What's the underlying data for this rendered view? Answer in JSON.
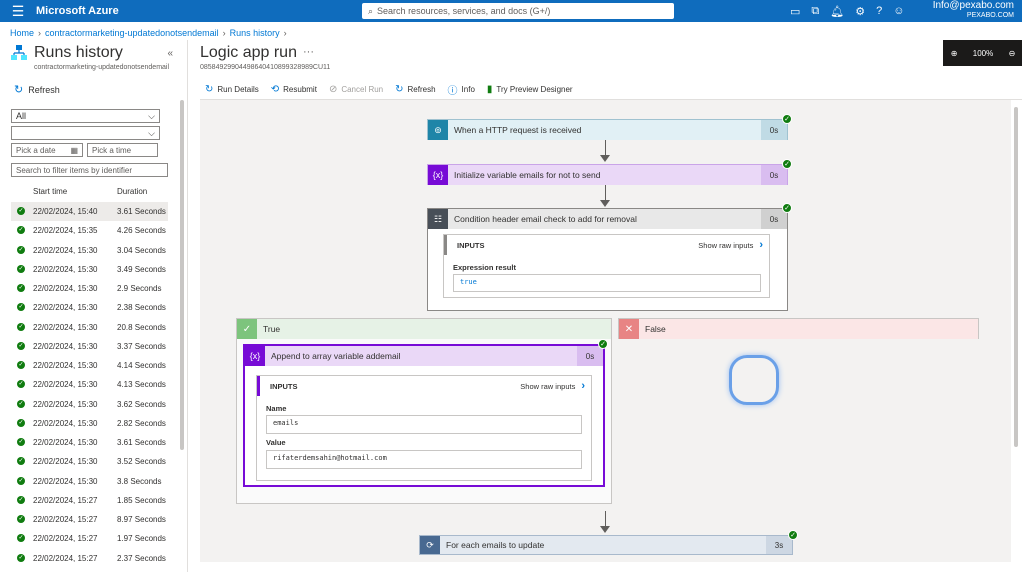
{
  "topbar": {
    "brand": "Microsoft Azure",
    "search_placeholder": "Search resources, services, and docs (G+/)",
    "user_email": "Info@pexabo.com",
    "user_tenant": "PEXABO.COM"
  },
  "breadcrumb": [
    "Home",
    "contractormarketing-updatedonotsendemail",
    "Runs history"
  ],
  "left": {
    "title": "Runs history",
    "subtitle": "contractormarketing-updatedonotsendemail",
    "refresh_label": "Refresh",
    "filter_status": "All",
    "filter_second": "",
    "date_placeholder": "Pick a date",
    "time_placeholder": "Pick a time",
    "search_placeholder": "Search to filter items by identifier",
    "col_start": "Start time",
    "col_duration": "Duration",
    "runs": [
      {
        "start": "22/02/2024, 15:40",
        "duration": "3.61 Seconds"
      },
      {
        "start": "22/02/2024, 15:35",
        "duration": "4.26 Seconds"
      },
      {
        "start": "22/02/2024, 15:30",
        "duration": "3.04 Seconds"
      },
      {
        "start": "22/02/2024, 15:30",
        "duration": "3.49 Seconds"
      },
      {
        "start": "22/02/2024, 15:30",
        "duration": "2.9 Seconds"
      },
      {
        "start": "22/02/2024, 15:30",
        "duration": "2.38 Seconds"
      },
      {
        "start": "22/02/2024, 15:30",
        "duration": "20.8 Seconds"
      },
      {
        "start": "22/02/2024, 15:30",
        "duration": "3.37 Seconds"
      },
      {
        "start": "22/02/2024, 15:30",
        "duration": "4.14 Seconds"
      },
      {
        "start": "22/02/2024, 15:30",
        "duration": "4.13 Seconds"
      },
      {
        "start": "22/02/2024, 15:30",
        "duration": "3.62 Seconds"
      },
      {
        "start": "22/02/2024, 15:30",
        "duration": "2.82 Seconds"
      },
      {
        "start": "22/02/2024, 15:30",
        "duration": "3.61 Seconds"
      },
      {
        "start": "22/02/2024, 15:30",
        "duration": "3.52 Seconds"
      },
      {
        "start": "22/02/2024, 15:30",
        "duration": "3.8 Seconds"
      },
      {
        "start": "22/02/2024, 15:27",
        "duration": "1.85 Seconds"
      },
      {
        "start": "22/02/2024, 15:27",
        "duration": "8.97 Seconds"
      },
      {
        "start": "22/02/2024, 15:27",
        "duration": "1.97 Seconds"
      },
      {
        "start": "22/02/2024, 15:27",
        "duration": "2.37 Seconds"
      }
    ]
  },
  "main": {
    "title": "Logic app run",
    "run_id": "08584929904498640410899328989CU11",
    "toolbar": {
      "run_details": "Run Details",
      "resubmit": "Resubmit",
      "cancel_run": "Cancel Run",
      "refresh": "Refresh",
      "info": "Info",
      "preview": "Try Preview Designer"
    },
    "zoom_level": "100%"
  },
  "flow": {
    "trigger": {
      "label": "When a HTTP request is received",
      "duration": "0s"
    },
    "init_var": {
      "label": "Initialize variable emails for not to send",
      "duration": "0s"
    },
    "condition": {
      "label": "Condition header email check to add for removal",
      "duration": "0s",
      "inputs_label": "INPUTS",
      "raw_label": "Show raw inputs",
      "expr_label": "Expression result",
      "expr_value": "true"
    },
    "true_branch": {
      "label": "True"
    },
    "false_branch": {
      "label": "False"
    },
    "append": {
      "label": "Append to array variable addemail",
      "duration": "0s",
      "inputs_label": "INPUTS",
      "raw_label": "Show raw inputs",
      "name_label": "Name",
      "name_value": "emails",
      "value_label": "Value",
      "value_value": "rifaterdemsahin@hotmail.com"
    },
    "foreach": {
      "label": "For each emails to update",
      "duration": "3s"
    }
  },
  "colors": {
    "azure_blue": "#0f6cbd",
    "trigger_teal": "#1f85a8",
    "variable_purple": "#770bd6",
    "condition_gray": "#484f58",
    "success_green": "#107c10",
    "false_red": "#e06666",
    "foreach_navy": "#486991"
  }
}
